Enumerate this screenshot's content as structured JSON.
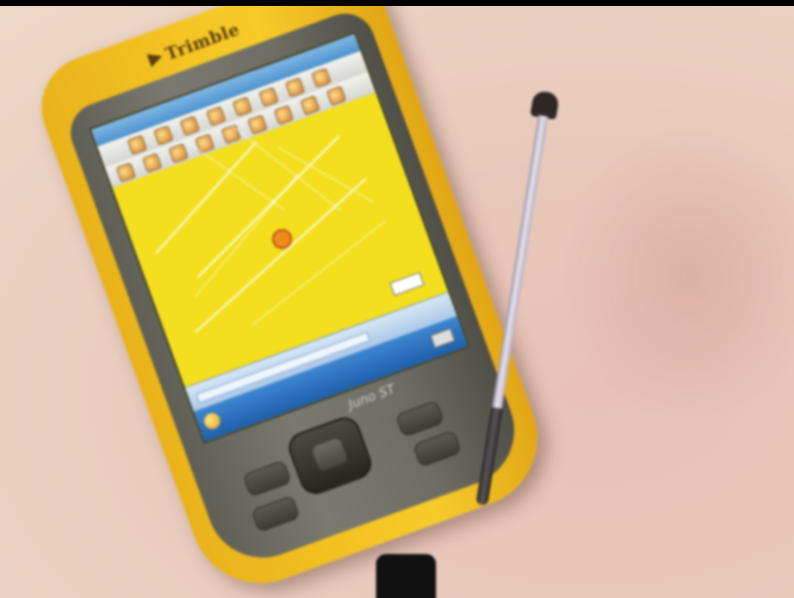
{
  "device": {
    "brand": "Trimble",
    "model": "Juno ST",
    "screen": {
      "window_title": "",
      "map_color": "#f3df1d",
      "accent_blue": "#1e5fab"
    }
  },
  "colors": {
    "device_body": "#f3c322",
    "device_face": "#6d6d63",
    "background": "#eacbbd"
  },
  "icons": {
    "brand_logo": "trimble-logo",
    "position": "gps-position-marker",
    "start": "windows-start-icon",
    "keyboard": "keyboard-icon"
  }
}
